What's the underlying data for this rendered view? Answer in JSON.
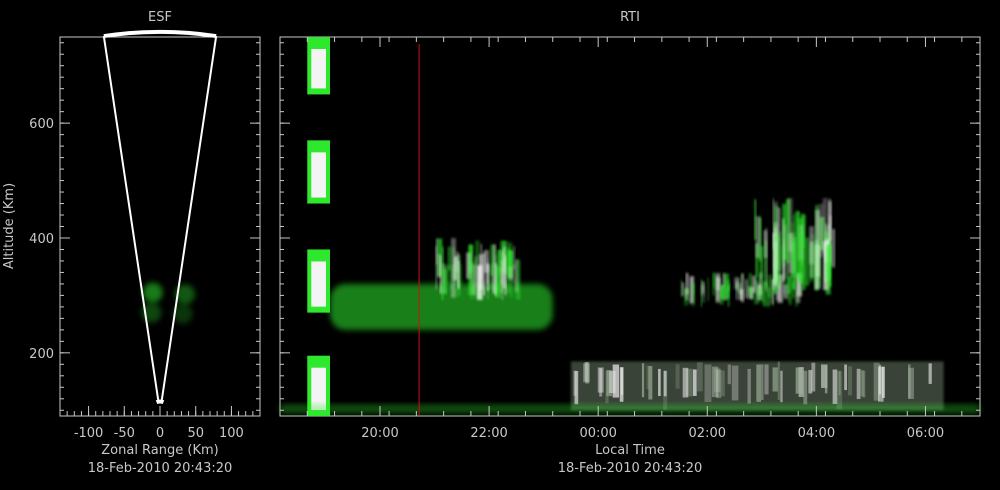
{
  "colors": {
    "background": "#000000",
    "axis": "#c8c8c8",
    "echo_green": "#2ee82e",
    "echo_white": "#f4f4f4",
    "time_marker": "#cc1111"
  },
  "chart_data": [
    {
      "type": "heatmap",
      "title": "ESF",
      "xlabel": "Zonal Range (Km)",
      "ylabel": "Altitude (Km)",
      "footer": "18-Feb-2010 20:43:20",
      "xlim": [
        -140,
        140
      ],
      "ylim": [
        90,
        750
      ],
      "x_ticks": [
        -100,
        -50,
        0,
        50,
        100
      ],
      "y_ticks": [
        200,
        400,
        600
      ],
      "fan": {
        "apex_altitude": 90,
        "top_altitude": 745,
        "half_angle_deg": 8.5
      },
      "echoes": [
        {
          "x": -10,
          "y": 305,
          "intensity": 0.7
        },
        {
          "x": 35,
          "y": 302,
          "intensity": 0.5
        },
        {
          "x": -12,
          "y": 270,
          "intensity": 0.4
        },
        {
          "x": 32,
          "y": 268,
          "intensity": 0.3
        }
      ]
    },
    {
      "type": "heatmap",
      "title": "RTI",
      "xlabel": "Local Time",
      "footer": "18-Feb-2010 20:43:20",
      "x_ticks": [
        "20:00",
        "22:00",
        "00:00",
        "02:00",
        "04:00",
        "06:00"
      ],
      "y_ticks": [
        200,
        400,
        600
      ],
      "xlim": [
        "18:10",
        "07:00"
      ],
      "ylim": [
        90,
        750
      ],
      "current_time": "20:43",
      "echo_regions": [
        {
          "t0": "18:40",
          "t1": "19:05",
          "y0": 90,
          "y1": 195,
          "color": "white"
        },
        {
          "t0": "18:40",
          "t1": "19:05",
          "y0": 270,
          "y1": 380,
          "color": "white"
        },
        {
          "t0": "18:40",
          "t1": "19:05",
          "y0": 460,
          "y1": 570,
          "color": "white"
        },
        {
          "t0": "18:40",
          "t1": "19:05",
          "y0": 650,
          "y1": 750,
          "color": "white"
        },
        {
          "t0": "19:05",
          "t1": "23:10",
          "y0": 240,
          "y1": 320,
          "color": "green"
        },
        {
          "t0": "21:00",
          "t1": "22:30",
          "y0": 290,
          "y1": 400,
          "color": "mixed"
        },
        {
          "t0": "01:30",
          "t1": "03:40",
          "y0": 280,
          "y1": 340,
          "color": "mixed"
        },
        {
          "t0": "02:50",
          "t1": "04:20",
          "y0": 300,
          "y1": 470,
          "color": "mixed"
        },
        {
          "t0": "23:30",
          "t1": "06:20",
          "y0": 100,
          "y1": 185,
          "color": "white"
        },
        {
          "t0": "18:10",
          "t1": "07:00",
          "y0": 95,
          "y1": 110,
          "color": "green"
        }
      ]
    }
  ]
}
